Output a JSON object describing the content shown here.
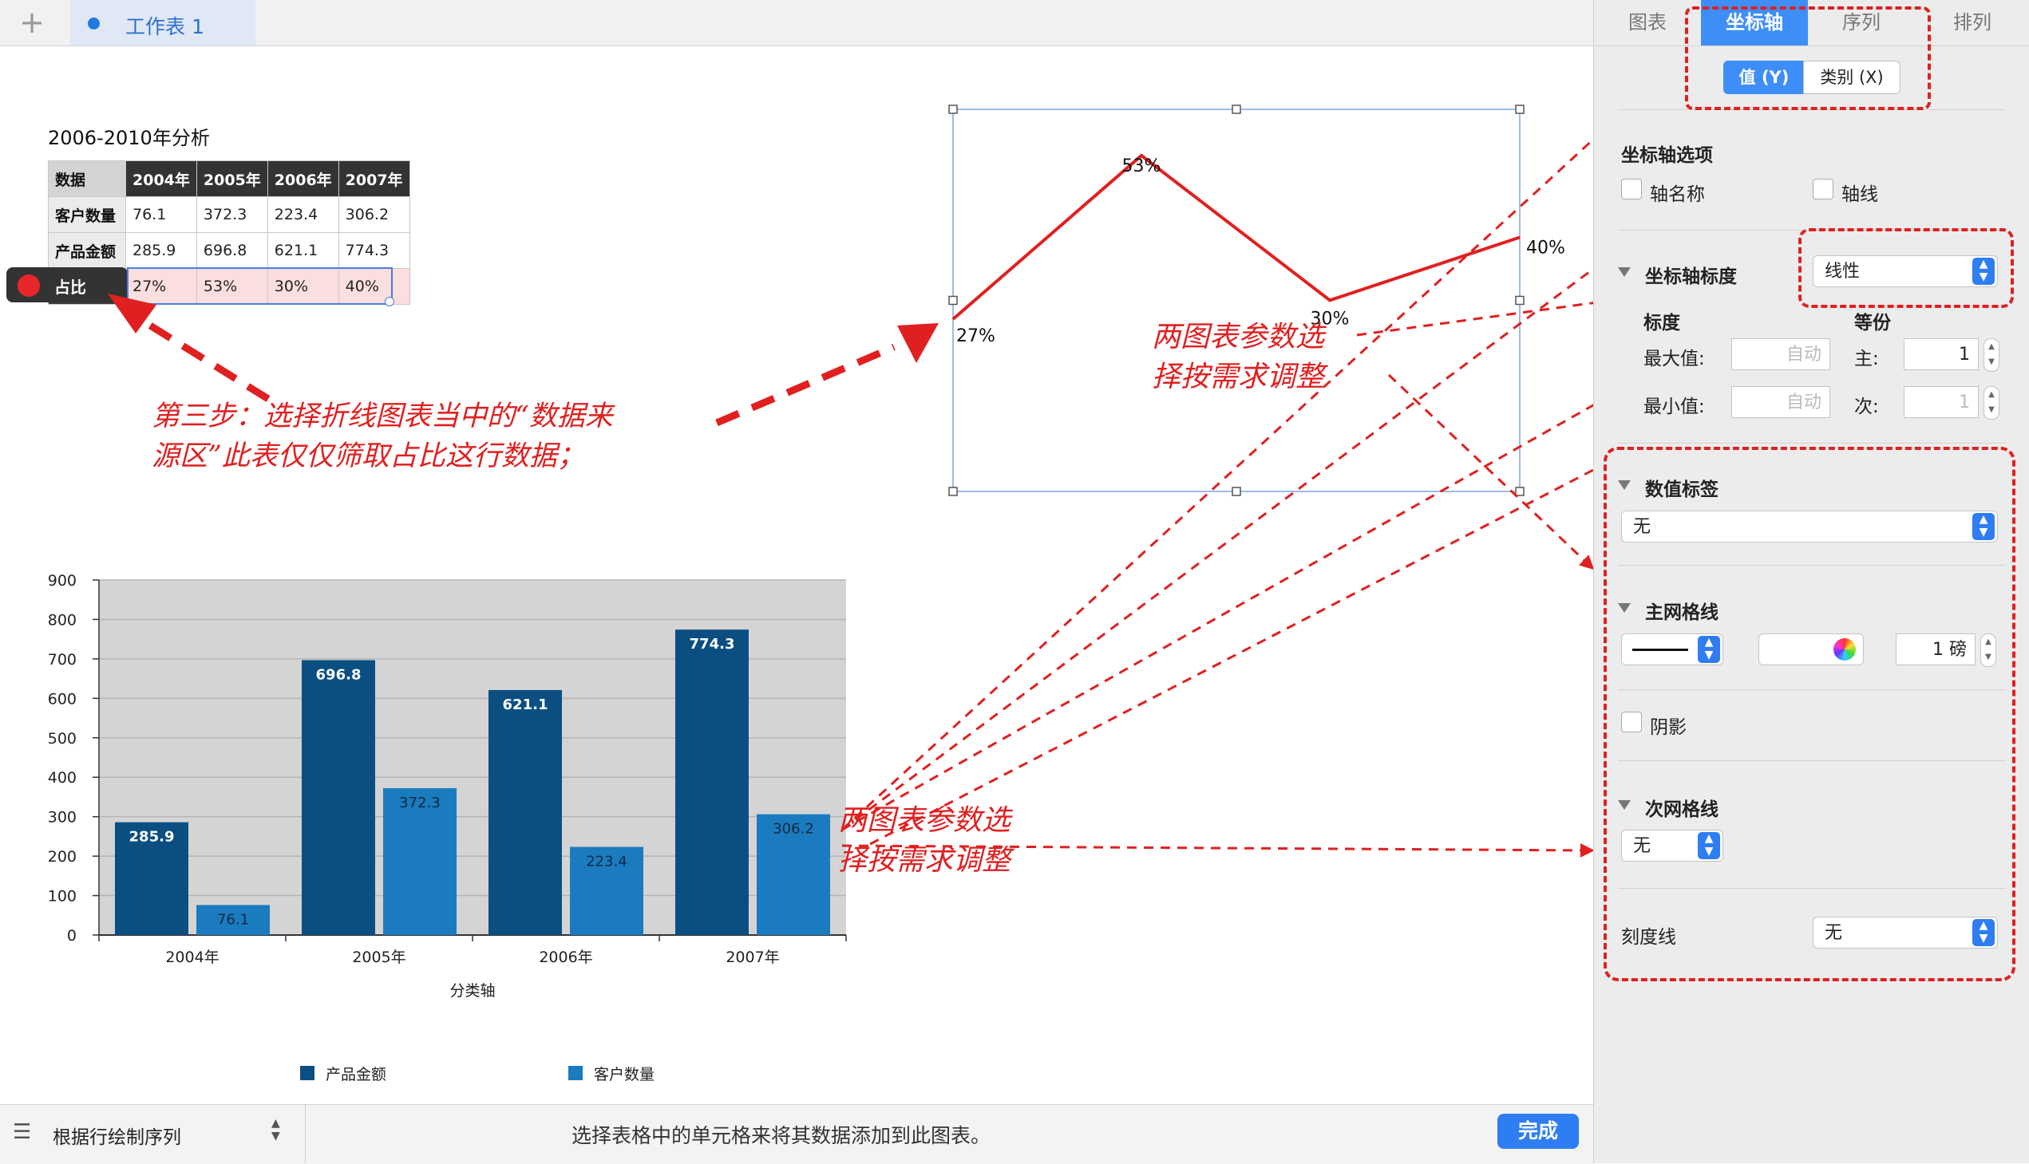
{
  "tabbar": {
    "add_icon": "plus-icon",
    "sheet_name": "工作表 1"
  },
  "table": {
    "title": "2006-2010年分析",
    "corner": "数据",
    "columns": [
      "2004年",
      "2005年",
      "2006年",
      "2007年"
    ],
    "rows": [
      {
        "label": "客户数量",
        "values": [
          "76.1",
          "372.3",
          "223.4",
          "306.2"
        ]
      },
      {
        "label": "产品金额",
        "values": [
          "285.9",
          "696.8",
          "621.1",
          "774.3"
        ]
      },
      {
        "label": "占比",
        "values": [
          "27%",
          "53%",
          "30%",
          "40%"
        ]
      }
    ]
  },
  "annotations": {
    "step3": "第三步：选择折线图表当中的“数据来\n源区”此表仅仅筛取占比这行数据；",
    "params_top": "两图表参数选\n择按需求调整",
    "params_bottom": "两图表参数选\n择按需求调整",
    "accent_color": "#e02020"
  },
  "chart_data": [
    {
      "type": "line",
      "categories": [
        "2004年",
        "2005年",
        "2006年",
        "2007年"
      ],
      "series": [
        {
          "name": "占比",
          "values": [
            27,
            53,
            30,
            40
          ],
          "labels": [
            "27%",
            "53%",
            "30%",
            "40%"
          ],
          "color": "#e02020"
        }
      ],
      "ylim": [
        0,
        60
      ]
    },
    {
      "type": "bar",
      "categories": [
        "2004年",
        "2005年",
        "2006年",
        "2007年"
      ],
      "series": [
        {
          "name": "产品金额",
          "values": [
            285.9,
            696.8,
            621.1,
            774.3
          ],
          "color": "#0b4f82"
        },
        {
          "name": "客户数量",
          "values": [
            76.1,
            372.3,
            223.4,
            306.2
          ],
          "color": "#1b7bbf"
        }
      ],
      "xlabel": "分类轴",
      "ylim": [
        0,
        900
      ],
      "yticks": [
        "0",
        "100",
        "200",
        "300",
        "400",
        "500",
        "600",
        "700",
        "800",
        "900"
      ],
      "grid": true,
      "legend": "bottom"
    }
  ],
  "panel": {
    "tabs": [
      "图表",
      "坐标轴",
      "序列",
      "排列"
    ],
    "active_tab": "坐标轴",
    "segments": [
      "值 (Y)",
      "类别 (X)"
    ],
    "axis_options_title": "坐标轴选项",
    "axis_name": "轴名称",
    "axis_line": "轴线",
    "scale_title": "坐标轴标度",
    "scale_value": "线性",
    "scale_label": "标度",
    "divisions_label": "等份",
    "max_label": "最大值:",
    "min_label": "最小值:",
    "auto": "自动",
    "major_label": "主:",
    "minor_label": "次:",
    "major_value": "1",
    "minor_value": "1",
    "value_labels_title": "数值标签",
    "value_labels_value": "无",
    "major_grid_title": "主网格线",
    "major_grid_weight": "1 磅",
    "shadow_label": "阴影",
    "minor_grid_title": "次网格线",
    "minor_grid_value": "无",
    "tick_marks_label": "刻度线",
    "tick_marks_value": "无"
  },
  "bottombar": {
    "series_mode": "根据行绘制序列",
    "hint": "选择表格中的单元格来将其数据添加到此图表。",
    "done": "完成"
  }
}
